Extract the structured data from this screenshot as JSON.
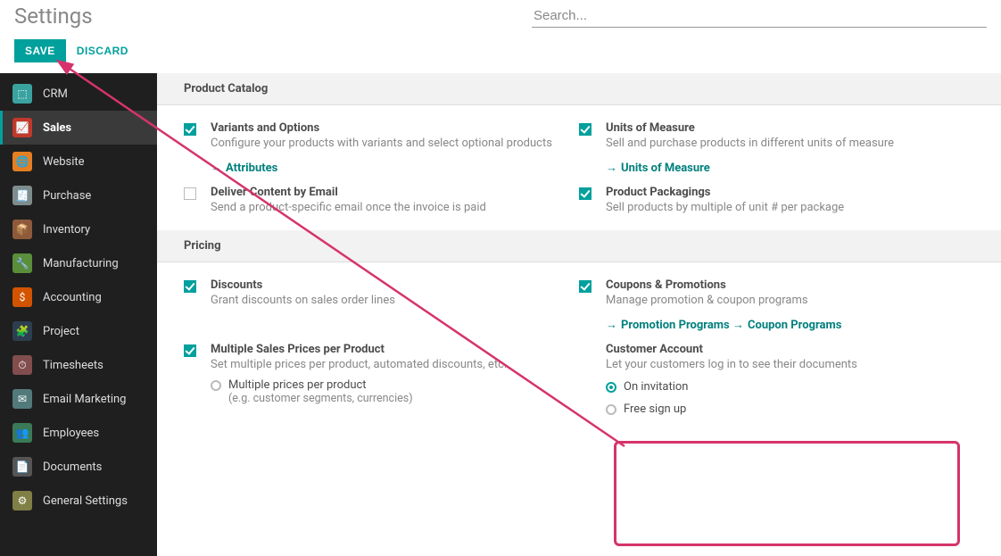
{
  "header": {
    "title": "Settings",
    "search_placeholder": "Search..."
  },
  "actions": {
    "save": "SAVE",
    "discard": "DISCARD"
  },
  "sidebar": {
    "items": [
      {
        "label": "CRM",
        "color": "#3aa3a0"
      },
      {
        "label": "Sales",
        "color": "#c0392b"
      },
      {
        "label": "Website",
        "color": "#e67e22"
      },
      {
        "label": "Purchase",
        "color": "#7f8c8d"
      },
      {
        "label": "Inventory",
        "color": "#8e5a3b"
      },
      {
        "label": "Manufacturing",
        "color": "#5a8e3b"
      },
      {
        "label": "Accounting",
        "color": "#d35400"
      },
      {
        "label": "Project",
        "color": "#2c3e50"
      },
      {
        "label": "Timesheets",
        "color": "#814d4d"
      },
      {
        "label": "Email Marketing",
        "color": "#527a7a"
      },
      {
        "label": "Employees",
        "color": "#3b7a57"
      },
      {
        "label": "Documents",
        "color": "#555555"
      },
      {
        "label": "General Settings",
        "color": "#7f7f46"
      }
    ],
    "active_index": 1
  },
  "sections": {
    "product_catalog": {
      "title": "Product Catalog",
      "variants": {
        "title": "Variants and Options",
        "desc": "Configure your products with variants and select optional products",
        "link": "Attributes"
      },
      "uom": {
        "title": "Units of Measure",
        "desc": "Sell and purchase products in different units of measure",
        "link": "Units of Measure"
      },
      "deliver": {
        "title": "Deliver Content by Email",
        "desc": "Send a product-specific email once the invoice is paid"
      },
      "packaging": {
        "title": "Product Packagings",
        "desc": "Sell products by multiple of unit # per package"
      }
    },
    "pricing": {
      "title": "Pricing",
      "discounts": {
        "title": "Discounts",
        "desc": "Grant discounts on sales order lines"
      },
      "coupons": {
        "title": "Coupons & Promotions",
        "desc": "Manage promotion & coupon programs",
        "link1": "Promotion Programs",
        "link2": "Coupon Programs"
      },
      "multi": {
        "title": "Multiple Sales Prices per Product",
        "desc": "Set multiple prices per product, automated discounts, etc.",
        "opt1": "Multiple prices per product",
        "opt1_desc": "(e.g. customer segments, currencies)"
      },
      "account": {
        "title": "Customer Account",
        "desc": "Let your customers log in to see their documents",
        "opt1": "On invitation",
        "opt2": "Free sign up"
      }
    }
  }
}
